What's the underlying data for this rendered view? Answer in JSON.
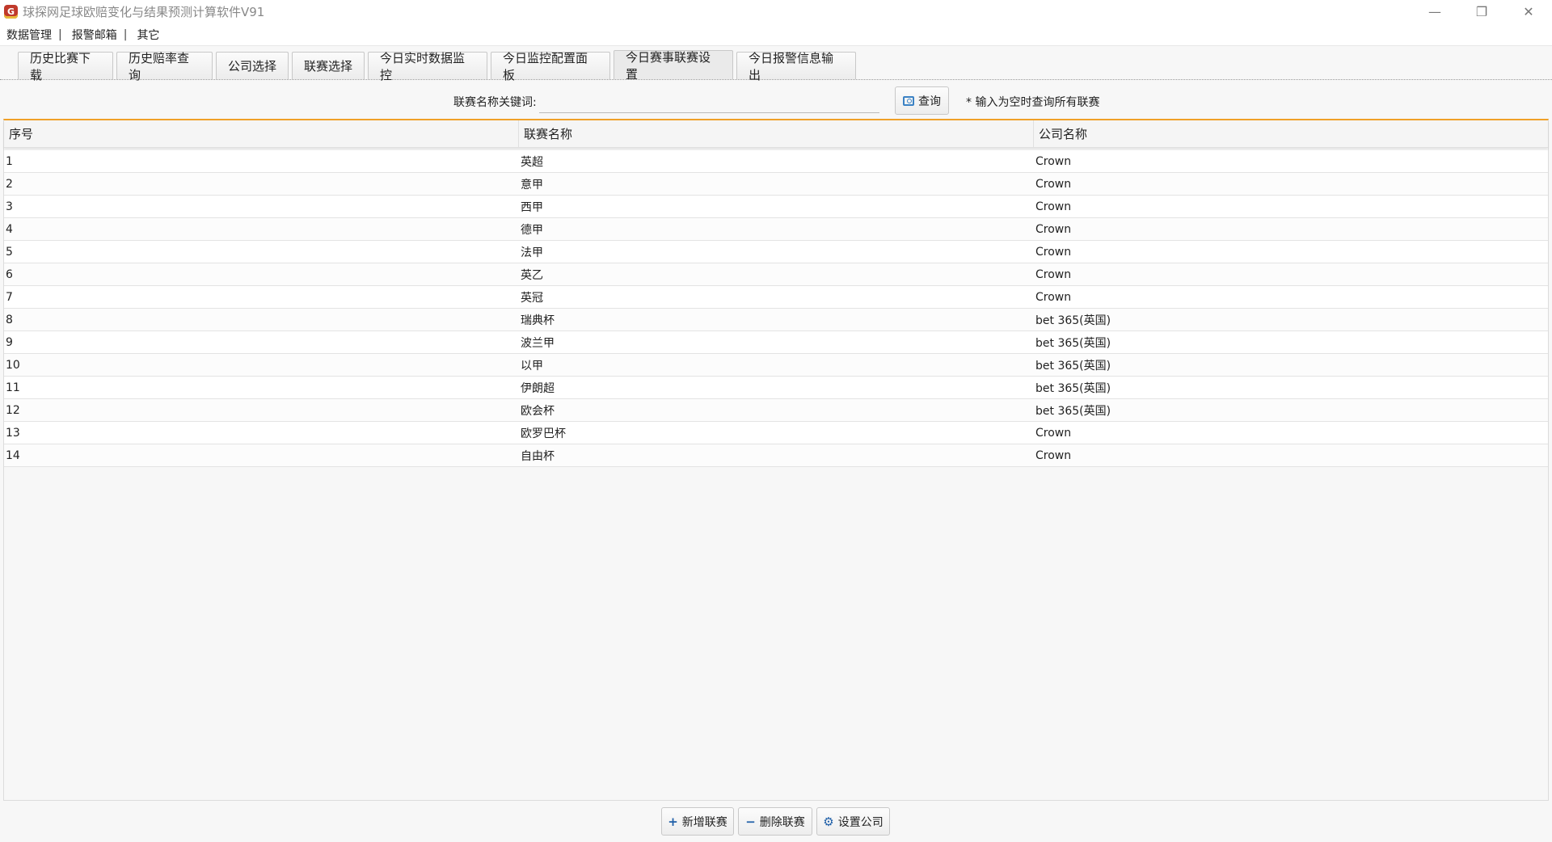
{
  "window": {
    "title": "球探网足球欧赔变化与结果预测计算软件V91",
    "icon_letter": "G",
    "minimize": "—",
    "restore": "❐",
    "close": "✕"
  },
  "menu": {
    "items": [
      "数据管理",
      "报警邮箱",
      "其它"
    ],
    "separator": "|"
  },
  "tabs": [
    {
      "label": "历史比赛下载",
      "active": false
    },
    {
      "label": "历史赔率查询",
      "active": false
    },
    {
      "label": "公司选择",
      "active": false
    },
    {
      "label": "联赛选择",
      "active": false
    },
    {
      "label": "今日实时数据监控",
      "active": false
    },
    {
      "label": "今日监控配置面板",
      "active": false
    },
    {
      "label": "今日赛事联赛设置",
      "active": true
    },
    {
      "label": "今日报警信息输出",
      "active": false
    }
  ],
  "search": {
    "label": "联赛名称关键词:",
    "value": "",
    "button": "查询",
    "hint": "* 输入为空时查询所有联赛"
  },
  "table": {
    "columns": [
      "序号",
      "联赛名称",
      "公司名称"
    ],
    "rows": [
      [
        "1",
        "英超",
        "Crown"
      ],
      [
        "2",
        "意甲",
        "Crown"
      ],
      [
        "3",
        "西甲",
        "Crown"
      ],
      [
        "4",
        "德甲",
        "Crown"
      ],
      [
        "5",
        "法甲",
        "Crown"
      ],
      [
        "6",
        "英乙",
        "Crown"
      ],
      [
        "7",
        "英冠",
        "Crown"
      ],
      [
        "8",
        "瑞典杯",
        "bet 365(英国)"
      ],
      [
        "9",
        "波兰甲",
        "bet 365(英国)"
      ],
      [
        "10",
        "以甲",
        "bet 365(英国)"
      ],
      [
        "11",
        "伊朗超",
        "bet 365(英国)"
      ],
      [
        "12",
        "欧会杯",
        "bet 365(英国)"
      ],
      [
        "13",
        "欧罗巴杯",
        "Crown"
      ],
      [
        "14",
        "自由杯",
        "Crown"
      ]
    ]
  },
  "actions": {
    "add": {
      "icon": "+",
      "label": "新增联赛"
    },
    "delete": {
      "icon": "−",
      "label": "删除联赛"
    },
    "company": {
      "icon": "⚙",
      "label": "设置公司"
    }
  }
}
